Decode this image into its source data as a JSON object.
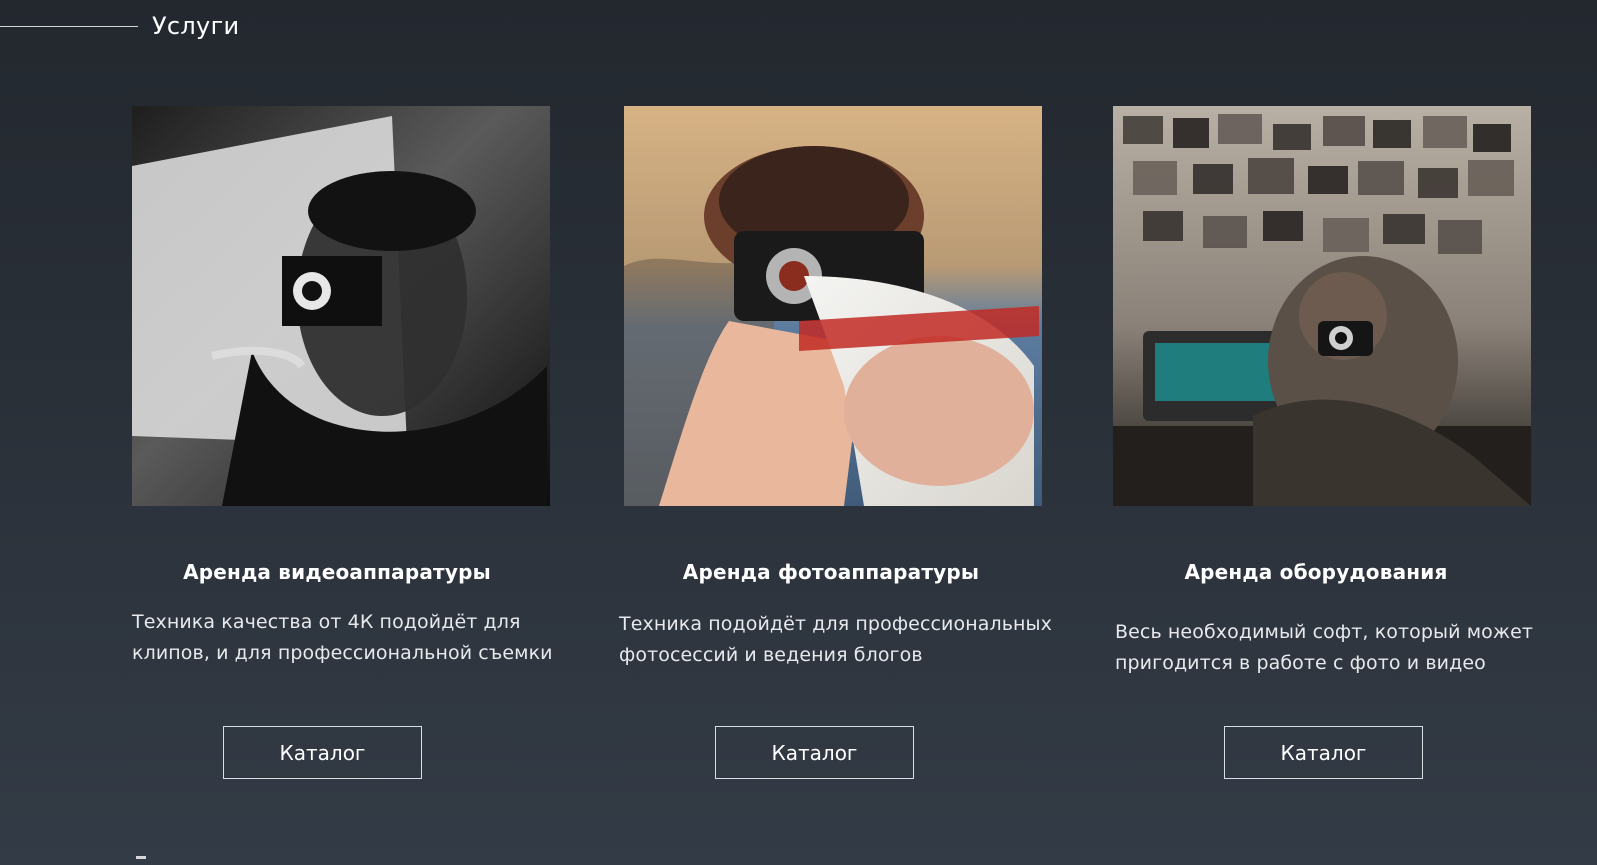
{
  "section": {
    "title": "Услуги"
  },
  "cards": [
    {
      "title": "Аренда видеоаппаратуры",
      "description": "Техника качества от 4К подойдёт для клипов, и для профессиональной съемки",
      "button_label": "Каталог",
      "image_icon": "photo-woman-with-vintage-camera"
    },
    {
      "title": "Аренда фотоаппаратуры",
      "description": "Техника подойдёт для профессиональных фотосессий и ведения блогов",
      "button_label": "Каталог",
      "image_icon": "photo-girl-with-camera-by-sea"
    },
    {
      "title": "Аренда оборудования",
      "description": "Весь необходимый софт, который может пригодится в работе с фото и видео",
      "button_label": "Каталог",
      "image_icon": "photo-person-in-room-with-photos"
    }
  ],
  "colors": {
    "background_top": "#23282f",
    "background_bottom": "#333b46",
    "text": "#ffffff",
    "button_border": "#d9dde2"
  }
}
